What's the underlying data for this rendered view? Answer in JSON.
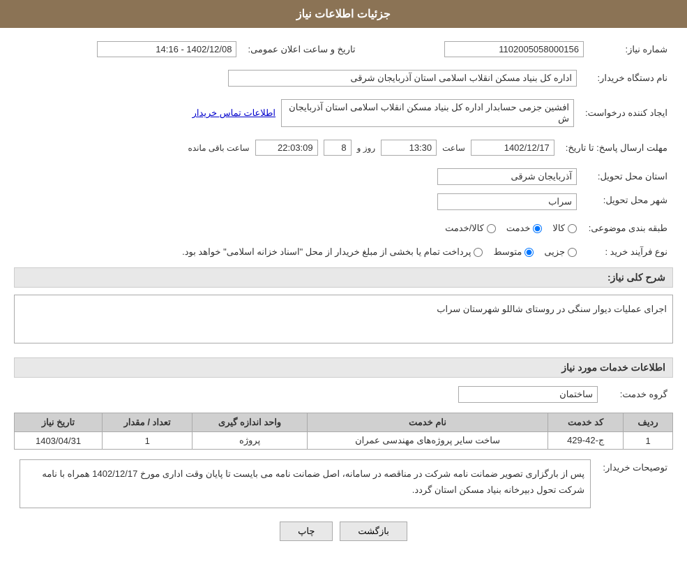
{
  "header": {
    "title": "جزئیات اطلاعات نیاز"
  },
  "fields": {
    "shomare_niaz_label": "شماره نیاز:",
    "shomare_niaz_value": "1102005058000156",
    "nam_dastgah_label": "نام دستگاه خریدار:",
    "nam_dastgah_value": "اداره کل بنیاد مسکن انقلاب اسلامی استان آذربایجان شرقی",
    "ijad_konande_label": "ایجاد کننده درخواست:",
    "ijad_konande_value": "افشین جزمی حسابدار اداره کل بنیاد مسکن انقلاب اسلامی استان آذربایجان ش",
    "ijad_konande_link": "اطلاعات تماس خریدار",
    "mohlat_label": "مهلت ارسال پاسخ: تا تاریخ:",
    "tarikh_value": "1402/12/17",
    "saat_label": "ساعت",
    "saat_value": "13:30",
    "rooz_label": "روز و",
    "rooz_value": "8",
    "baqi_label": "ساعت باقی مانده",
    "baqi_value": "22:03:09",
    "tarikh_elaan_label": "تاریخ و ساعت اعلان عمومی:",
    "tarikh_elaan_value": "1402/12/08 - 14:16",
    "ostan_label": "استان محل تحویل:",
    "ostan_value": "آذربایجان شرقی",
    "shahr_label": "شهر محل تحویل:",
    "shahr_value": "سراب",
    "tabaqe_label": "طبقه بندی موضوعی:",
    "tabaqe_options": [
      "کالا",
      "خدمت",
      "کالا/خدمت"
    ],
    "tabaqe_selected": "خدمت",
    "nooe_farayand_label": "نوع فرآیند خرید :",
    "nooe_options": [
      "جزیی",
      "متوسط",
      "پرداخت تمام یا بخشی از مبلغ خریدار از محل \"اسناد خزانه اسلامی\" خواهد بود."
    ],
    "nooe_selected": "متوسط",
    "sharh_label": "شرح کلی نیاز:",
    "sharh_value": "اجرای عملیات دیوار سنگی در روستای شاللو شهرستان سراب",
    "khadamat_label": "اطلاعات خدمات مورد نیاز",
    "grooh_label": "گروه خدمت:",
    "grooh_value": "ساختمان",
    "table": {
      "headers": [
        "ردیف",
        "کد خدمت",
        "نام خدمت",
        "واحد اندازه گیری",
        "تعداد / مقدار",
        "تاریخ نیاز"
      ],
      "rows": [
        {
          "radif": "1",
          "kod": "ج-42-429",
          "nam": "ساخت سایر پروژه‌های مهندسی عمران",
          "vahed": "پروژه",
          "tedad": "1",
          "tarikh": "1403/04/31"
        }
      ]
    },
    "tosihaat_label": "توصیحات خریدار:",
    "tosihaat_value": "پس از بارگزاری تصویر ضمانت نامه شرکت در مناقصه در سامانه، اصل ضمانت نامه می بایست تا پایان وقت اداری مورخ 1402/12/17 همراه با نامه شرکت تحول دبیرخانه بنیاد مسکن استان گردد."
  },
  "buttons": {
    "back_label": "بازگشت",
    "print_label": "چاپ"
  }
}
